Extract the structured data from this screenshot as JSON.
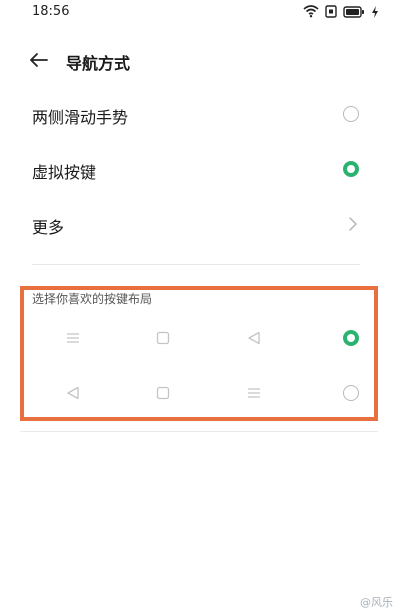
{
  "status_bar": {
    "time": "18:56",
    "icons": [
      "wifi-icon",
      "sim-icon",
      "battery-icon",
      "charging-icon"
    ]
  },
  "header": {
    "back_icon": "arrow-left-icon",
    "title": "导航方式"
  },
  "options": [
    {
      "label": "两侧滑动手势",
      "control": "radio",
      "selected": false
    },
    {
      "label": "虚拟按键",
      "control": "radio",
      "selected": true
    },
    {
      "label": "更多",
      "control": "chevron-right-icon"
    }
  ],
  "button_layout": {
    "section_label": "选择你喜欢的按键布局",
    "layouts": [
      {
        "icons": [
          "menu-icon",
          "square-icon",
          "triangle-back-icon"
        ],
        "selected": true
      },
      {
        "icons": [
          "triangle-back-icon",
          "square-icon",
          "menu-icon"
        ],
        "selected": false
      }
    ]
  },
  "watermark": "@风乐",
  "colors": {
    "accent": "#2ab36e",
    "highlight_border": "#e86f3e",
    "divider": "#e8e8e8"
  }
}
